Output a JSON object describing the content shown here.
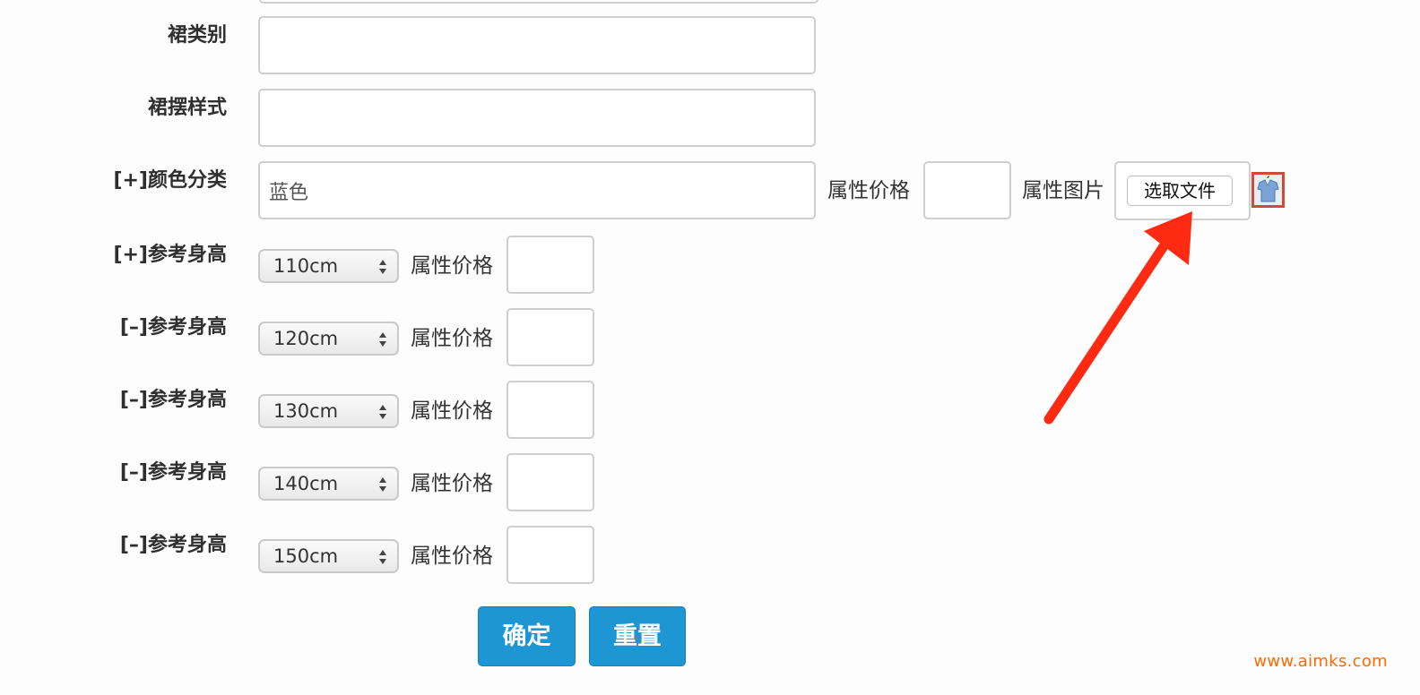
{
  "form": {
    "skirt_type": {
      "label": "裙类别",
      "value": ""
    },
    "hem_style": {
      "label": "裙摆样式",
      "value": ""
    },
    "color": {
      "toggle": "[+]",
      "label": "颜色分类",
      "value": "蓝色",
      "price_label": "属性价格",
      "price_value": "",
      "image_label": "属性图片",
      "file_button": "选取文件",
      "thumbnail_icon": "clothing-thumbnail-icon"
    },
    "heights": [
      {
        "toggle": "[+]",
        "label": "参考身高",
        "selected": "110cm",
        "price_label": "属性价格",
        "price_value": ""
      },
      {
        "toggle": "[–]",
        "label": "参考身高",
        "selected": "120cm",
        "price_label": "属性价格",
        "price_value": ""
      },
      {
        "toggle": "[–]",
        "label": "参考身高",
        "selected": "130cm",
        "price_label": "属性价格",
        "price_value": ""
      },
      {
        "toggle": "[–]",
        "label": "参考身高",
        "selected": "140cm",
        "price_label": "属性价格",
        "price_value": ""
      },
      {
        "toggle": "[–]",
        "label": "参考身高",
        "selected": "150cm",
        "price_label": "属性价格",
        "price_value": ""
      }
    ],
    "confirm_label": "确定",
    "reset_label": "重置"
  },
  "annotation": {
    "arrow_color": "#ff2a12"
  },
  "colors": {
    "button_bg": "#1e96d4",
    "watermark": "#ff6a00",
    "thumb_border": "#d14a36"
  },
  "watermark": "www.aimks.com"
}
